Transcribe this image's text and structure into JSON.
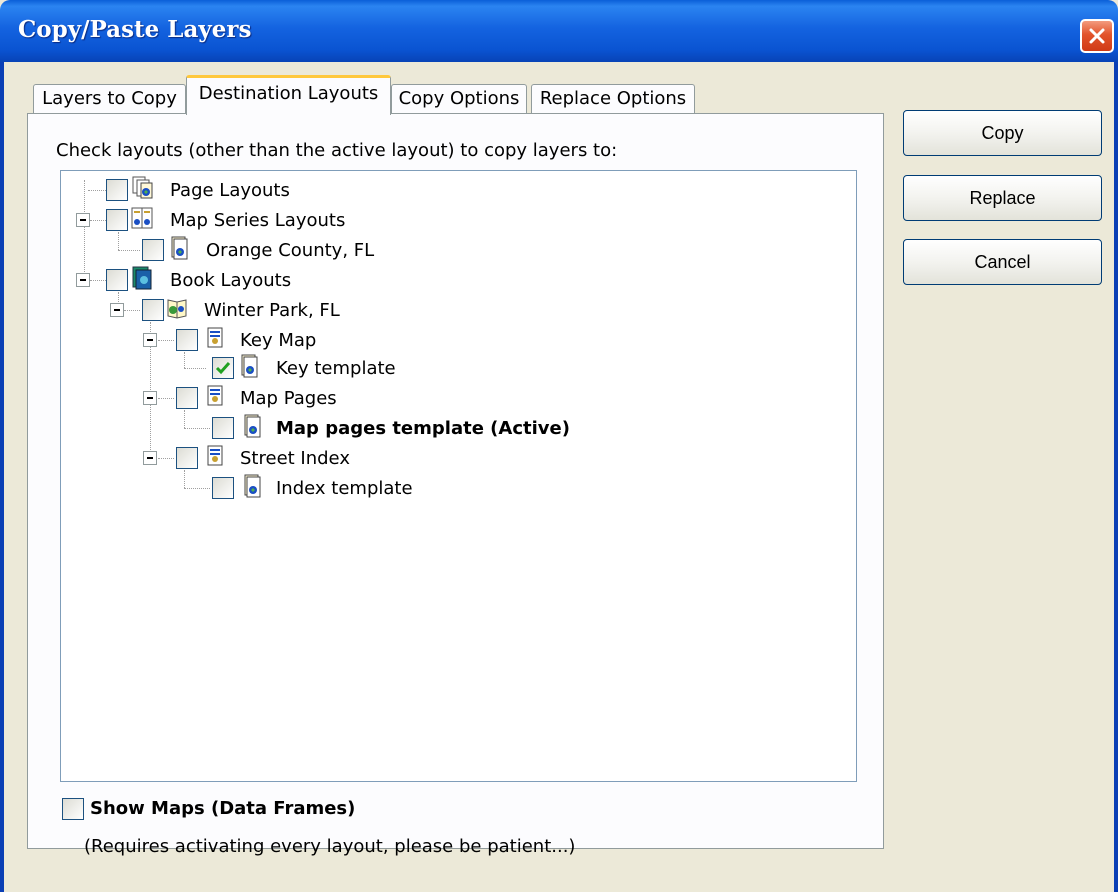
{
  "window": {
    "title": "Copy/Paste Layers"
  },
  "tabs": [
    {
      "label": "Layers to Copy",
      "active": false
    },
    {
      "label": "Destination Layouts",
      "active": true
    },
    {
      "label": "Copy Options",
      "active": false
    },
    {
      "label": "Replace Options",
      "active": false
    }
  ],
  "panel": {
    "instruction": "Check layouts (other than the active layout) to copy layers to:"
  },
  "tree": [
    {
      "label": "Page Layouts",
      "checked": false,
      "icon": "page-layouts-icon"
    },
    {
      "label": "Map Series Layouts",
      "checked": false,
      "icon": "map-series-icon",
      "expanded": true
    },
    {
      "label": "Orange County, FL",
      "checked": false,
      "icon": "layout-document-icon"
    },
    {
      "label": "Book Layouts",
      "checked": false,
      "icon": "book-layouts-icon",
      "expanded": true
    },
    {
      "label": "Winter Park, FL",
      "checked": false,
      "icon": "book-icon",
      "expanded": true
    },
    {
      "label": "Key Map",
      "checked": false,
      "icon": "section-icon",
      "expanded": true
    },
    {
      "label": "Key template",
      "checked": true,
      "icon": "layout-document-icon"
    },
    {
      "label": "Map Pages",
      "checked": false,
      "icon": "section-icon",
      "expanded": true
    },
    {
      "label": "Map pages template (Active)",
      "checked": false,
      "icon": "layout-document-icon",
      "bold": true
    },
    {
      "label": "Street Index",
      "checked": false,
      "icon": "section-icon",
      "expanded": true
    },
    {
      "label": "Index template",
      "checked": false,
      "icon": "layout-document-icon"
    }
  ],
  "buttons": {
    "copy": "Copy",
    "replace": "Replace",
    "cancel": "Cancel"
  },
  "options": {
    "show_maps_label": "Show Maps (Data Frames)",
    "show_maps_checked": false,
    "note": "(Requires activating every layout, please be patient...)"
  },
  "colors": {
    "title_bar": "#0a54d2",
    "close_button": "#e2542b",
    "tab_highlight": "#ffc83c",
    "check_mark": "#21a121"
  }
}
